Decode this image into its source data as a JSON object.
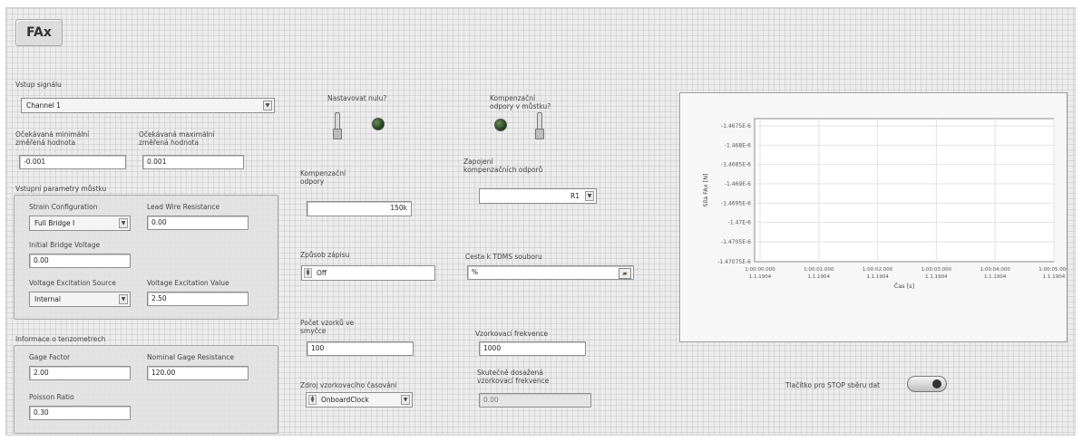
{
  "title": "FAx",
  "signal_input": {
    "label": "Vstup signálu",
    "value": "Channel 1"
  },
  "min_expected": {
    "label": "Očekávaná minimální\nzměřená hodnota",
    "value": "-0.001"
  },
  "max_expected": {
    "label": "Očekávaná maximální\nzměřená hodnota",
    "value": "0.001"
  },
  "bridge_params": {
    "label": "Vstupní parametry můstku",
    "strain_config": {
      "label": "Strain Configuration",
      "value": "Full Bridge I"
    },
    "lead_wire": {
      "label": "Lead Wire Resistance",
      "value": "0.00"
    },
    "initial_voltage": {
      "label": "Initial Bridge Voltage",
      "value": "0.00"
    },
    "excitation_source": {
      "label": "Voltage Excitation Source",
      "value": "Internal"
    },
    "excitation_value": {
      "label": "Voltage Excitation Value",
      "value": "2.50"
    }
  },
  "tenso_info": {
    "label": "Informace o tenzometrech",
    "gage_factor": {
      "label": "Gage Factor",
      "value": "2.00"
    },
    "nominal_resistance": {
      "label": "Nominal Gage Resistance",
      "value": "120.00"
    },
    "poisson": {
      "label": "Poisson Ratio",
      "value": "0.30"
    }
  },
  "zero": {
    "label": "Nastavovat nulu?"
  },
  "compensation_q": {
    "label": "Kompenzační\nodpory v můstku?"
  },
  "comp_resistors": {
    "label": "Kompenzační\nodpory",
    "value": "150k"
  },
  "comp_wiring": {
    "label": "Zapojení\nkompenzačních odporů",
    "value": "R1"
  },
  "write_mode": {
    "label": "Způsob zápisu",
    "value": "Off"
  },
  "tdms_path": {
    "label": "Cesta k TDMS souboru",
    "value": "%"
  },
  "samples": {
    "label": "Počet vzorků ve\nsmyčce",
    "value": "100"
  },
  "sample_rate": {
    "label": "Vzorkovací frekvence",
    "value": "1000"
  },
  "clock_source": {
    "label": "Zdroj vzorkovacího časování",
    "value": "OnboardClock"
  },
  "actual_rate": {
    "label": "Skutečně dosažená\nvzorkovací frekvence",
    "value": "0.00"
  },
  "stop_button": {
    "label": "Tlačítko pro STOP sběru dat"
  },
  "colors": {
    "panel": "#ececec",
    "led": "#2e5a1e",
    "field": "#ffffff"
  },
  "chart_data": {
    "type": "line",
    "ylabel": "Síla FAx [N]",
    "xlabel": "Čas [s]",
    "yticks": [
      "-1.4675E-6",
      "-1.468E-6",
      "-1.4685E-6",
      "-1.469E-6",
      "-1.4695E-6",
      "-1.47E-6",
      "-1.4705E-6",
      "-1.47075E-6"
    ],
    "xticks": [
      {
        "time": "1:00:00.000",
        "date": "1.1.1904"
      },
      {
        "time": "1:00:01.000",
        "date": "1.1.1904"
      },
      {
        "time": "1:00:02.000",
        "date": "1.1.1904"
      },
      {
        "time": "1:00:03.000",
        "date": "1.1.1904"
      },
      {
        "time": "1:00:04.000",
        "date": "1.1.1904"
      },
      {
        "time": "1:00:05.000",
        "date": "1.1.1904"
      }
    ],
    "series": [],
    "grid": true
  }
}
